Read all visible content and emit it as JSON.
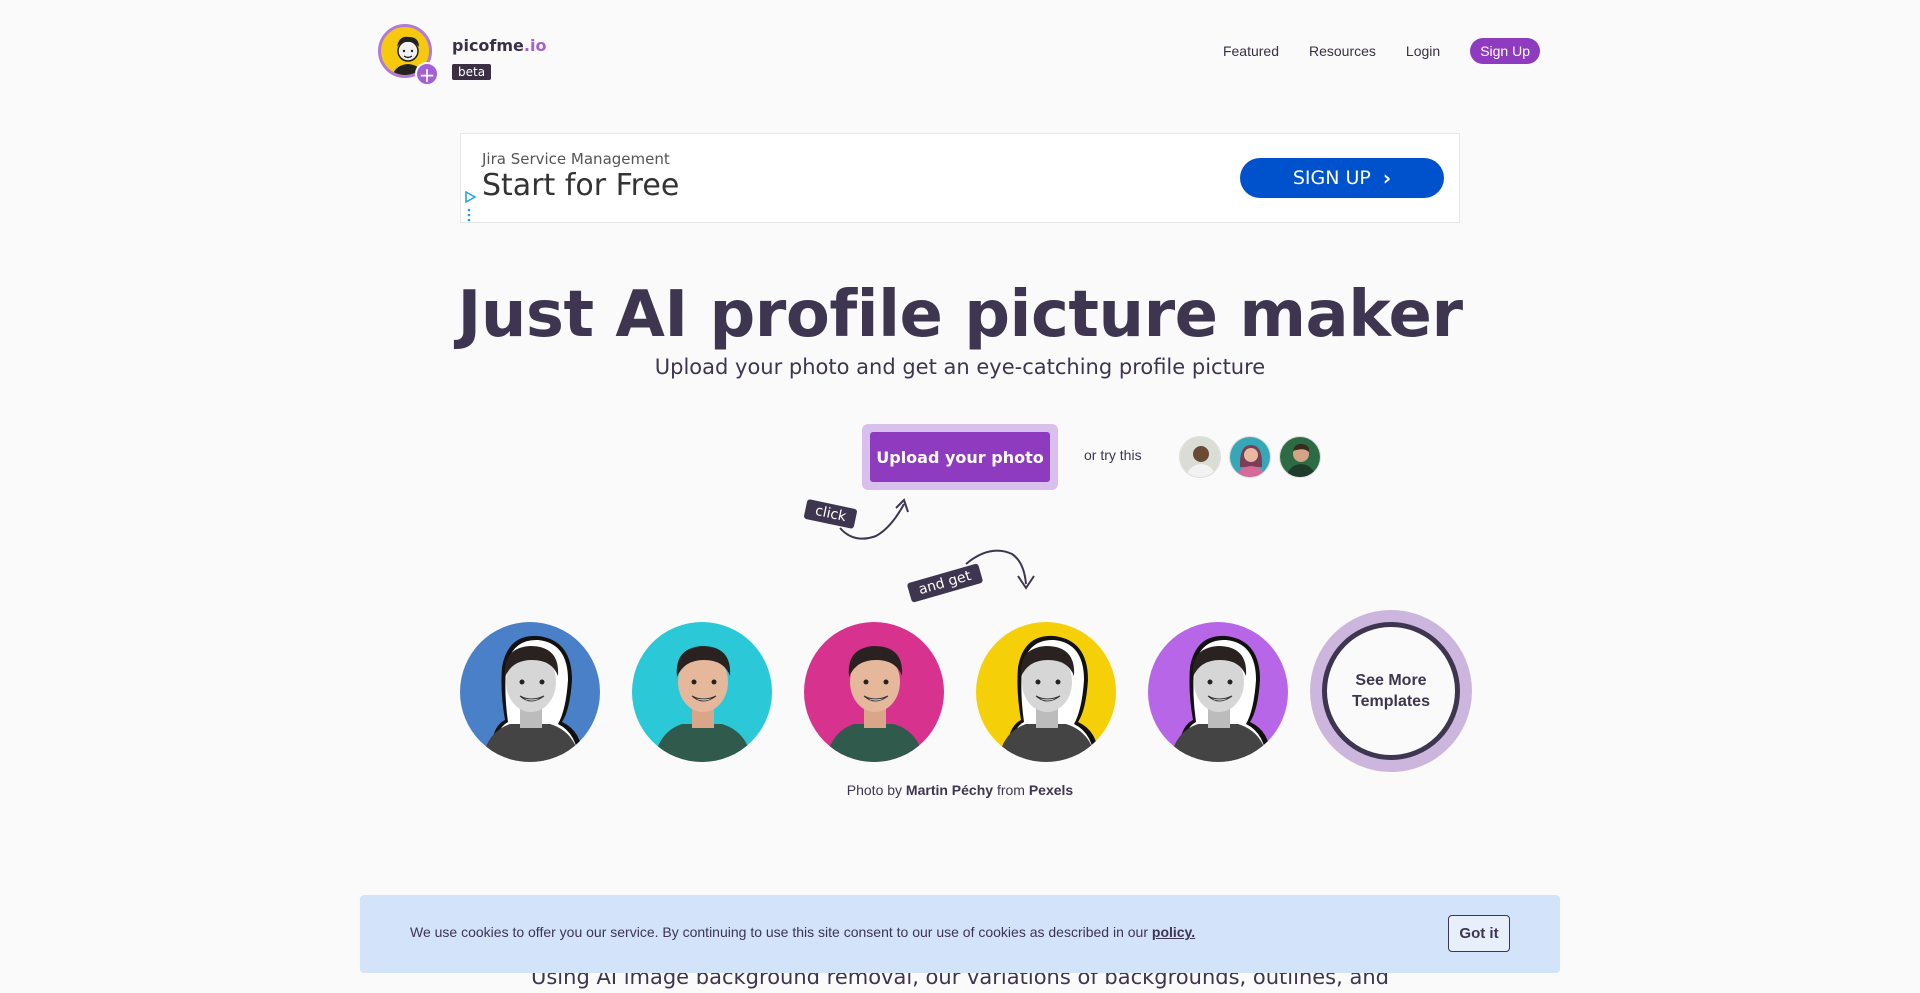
{
  "header": {
    "brand_name": "picofme",
    "brand_tld": ".io",
    "beta_label": "beta",
    "nav": {
      "featured": "Featured",
      "resources": "Resources",
      "login": "Login",
      "signup": "Sign Up"
    }
  },
  "ad": {
    "subtitle": "Jira Service Management",
    "title": "Start for Free",
    "button": "SIGN UP",
    "button_icon": "chevron-right-icon"
  },
  "hero": {
    "title": "Just AI profile picture maker",
    "subtitle": "Upload your photo and get an eye-catching profile picture",
    "upload_button": "Upload your photo",
    "try_this": "or try this",
    "tag_click": "click",
    "tag_and_get": "and get"
  },
  "templates": {
    "colors": [
      "#4a80c8",
      "#2bc8d8",
      "#d8328f",
      "#f5cf08",
      "#b866e8"
    ],
    "see_more": "See More Templates"
  },
  "credit": {
    "prefix": "Photo by",
    "author": "Martin Péchy",
    "middle": "from",
    "source": "Pexels"
  },
  "bottom_text": "Using AI image background removal, our variations of backgrounds, outlines, and",
  "cookie": {
    "text": "We use cookies to offer you our service. By continuing to use this site consent to our use of cookies as described in our",
    "link": "policy.",
    "button": "Got it"
  },
  "colors": {
    "brand": "#8e3bbf",
    "ad_button": "#0052cc",
    "cookie_bg": "#d2e3fa"
  }
}
